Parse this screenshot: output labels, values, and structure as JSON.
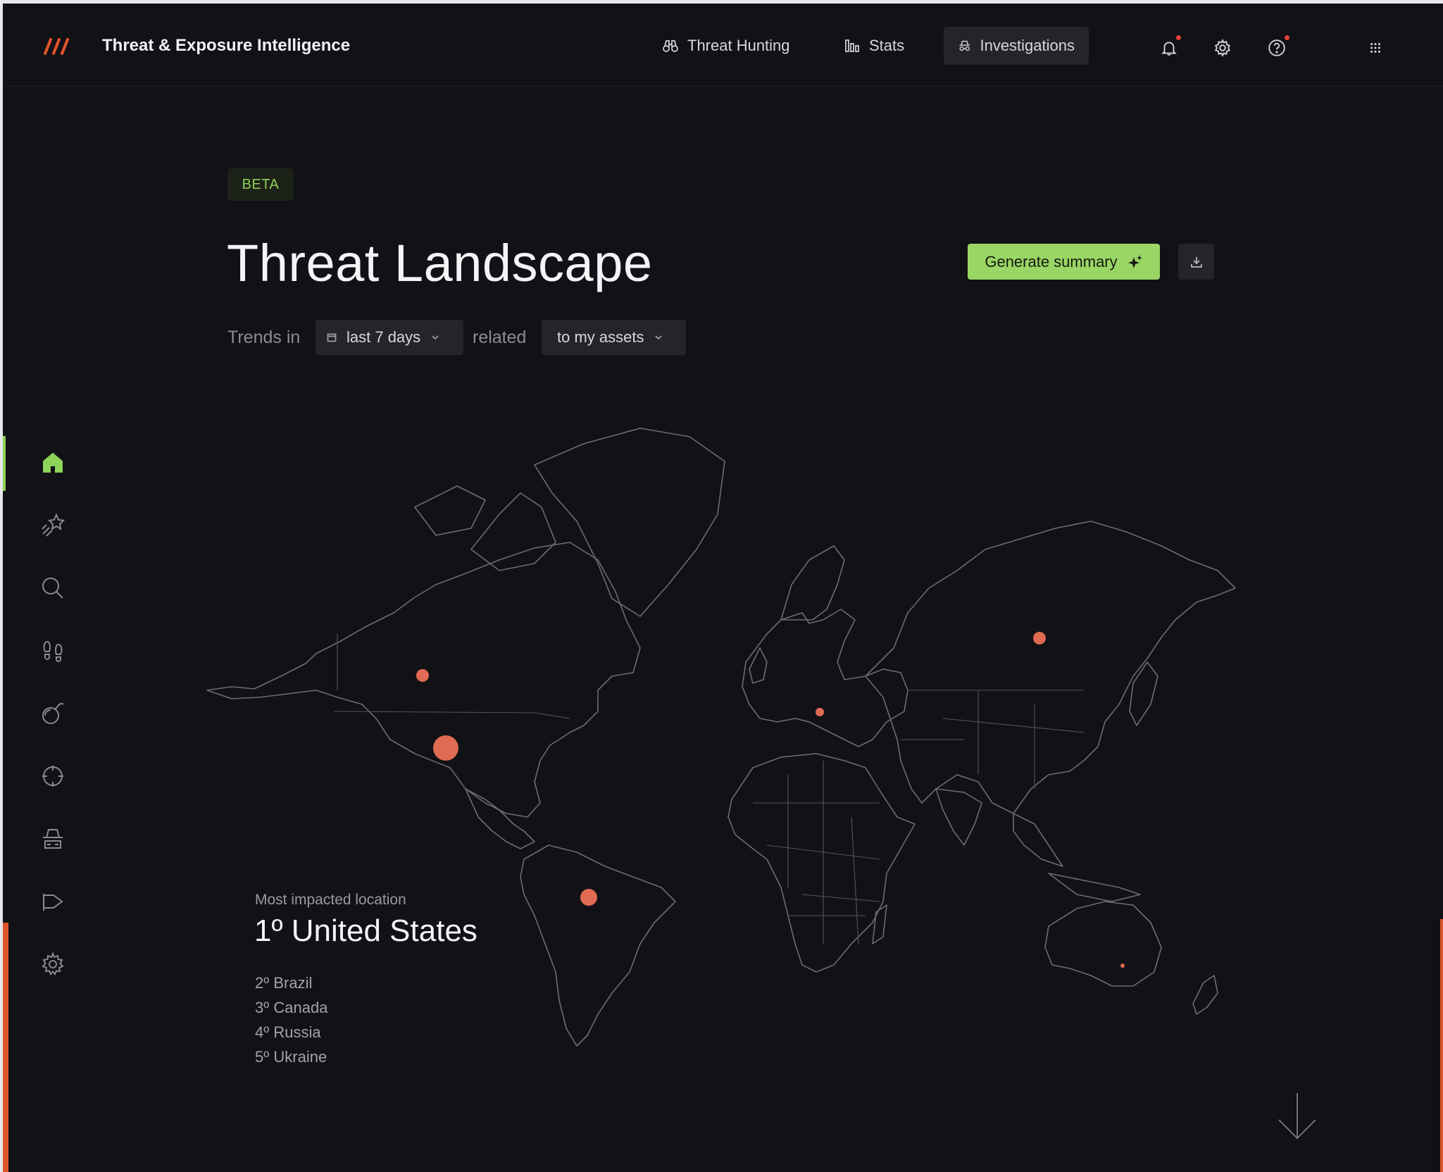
{
  "app": {
    "title": "Threat & Exposure Intelligence"
  },
  "nav": {
    "items": [
      {
        "label": "Threat Hunting",
        "icon": "binoculars-icon"
      },
      {
        "label": "Stats",
        "icon": "bar-chart-icon"
      },
      {
        "label": "Investigations",
        "icon": "detective-icon",
        "active": true
      }
    ]
  },
  "toolbar": {
    "icons": [
      "bell-icon",
      "gear-icon",
      "help-icon",
      "apps-grid-icon"
    ]
  },
  "sidebar": {
    "items": [
      "home-icon",
      "shooting-star-icon",
      "search-icon",
      "footprints-icon",
      "bomb-icon",
      "crosshair-icon",
      "spy-icon",
      "megaphone-icon",
      "settings-icon"
    ],
    "active": "home-icon"
  },
  "header": {
    "badge": "BETA",
    "title": "Threat Landscape",
    "generate_label": "Generate summary"
  },
  "filters": {
    "prefix": "Trends in",
    "period": "last 7 days",
    "joiner": "related",
    "scope": "to my assets"
  },
  "impact": {
    "label": "Most impacted location",
    "top": "1º United States",
    "ranks": [
      "2º Brazil",
      "3º Canada",
      "4º Russia",
      "5º Ukraine"
    ]
  },
  "colors": {
    "accent": "#9ad665",
    "marker": "#e16a54",
    "background": "#121116",
    "brand": "#e0542a"
  }
}
